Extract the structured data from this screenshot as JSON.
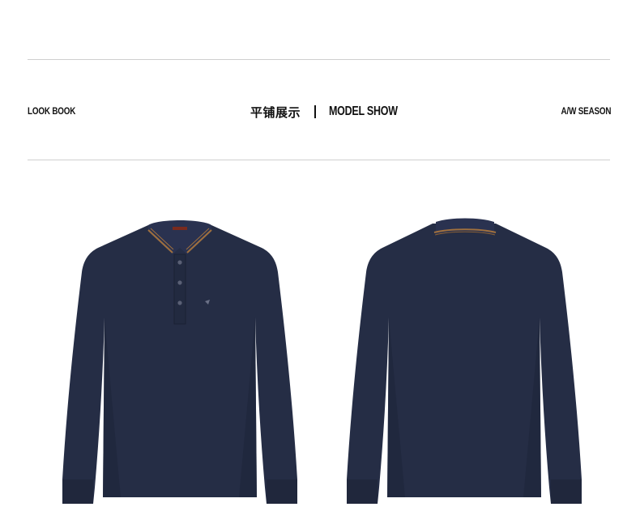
{
  "header": {
    "left_label": "LOOK BOOK",
    "title_cn": "平铺展示",
    "title_en": "MODEL SHOW",
    "right_label": "A/W SEASON"
  },
  "colors": {
    "garment_navy": "#252d45",
    "collar_stripe": "#a0703e",
    "rule": "#cfcfcf"
  },
  "images": [
    {
      "name": "polo-front",
      "view": "front"
    },
    {
      "name": "polo-back",
      "view": "back"
    }
  ]
}
